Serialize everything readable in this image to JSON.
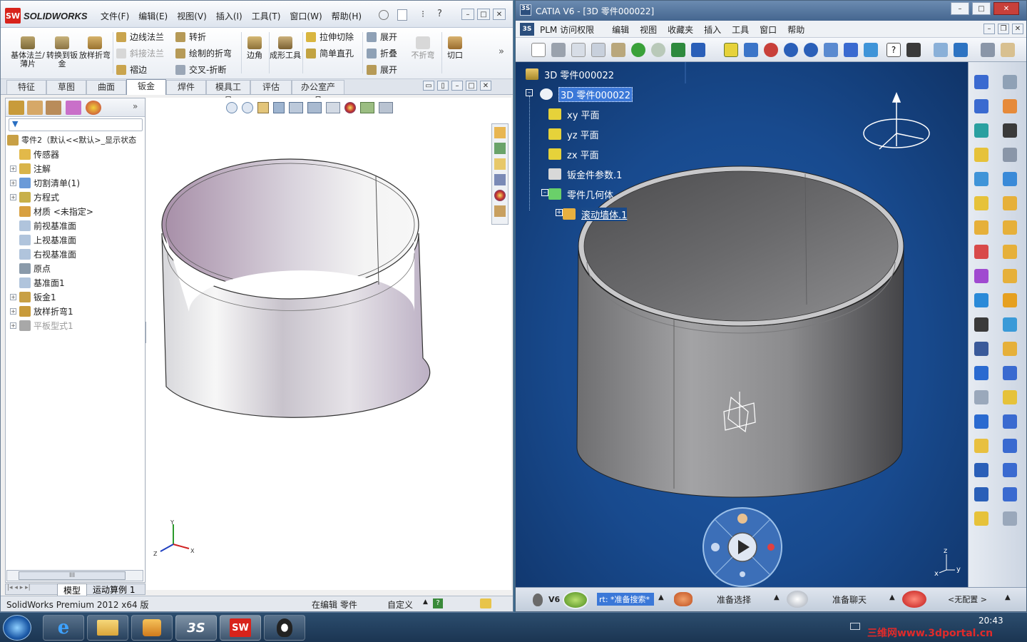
{
  "solidworks": {
    "logo_prefix": "SW",
    "logo_text": "SOLIDWORKS",
    "menu": [
      "文件(F)",
      "编辑(E)",
      "视图(V)",
      "插入(I)",
      "工具(T)",
      "窗口(W)",
      "帮助(H)"
    ],
    "ribbon_big": [
      {
        "label": "基体法兰/薄片"
      },
      {
        "label": "转换到钣金"
      },
      {
        "label": "放样折弯"
      }
    ],
    "ribbon_col1": [
      {
        "label": "边线法兰",
        "disabled": false
      },
      {
        "label": "斜接法兰",
        "disabled": true
      },
      {
        "label": "褶边",
        "disabled": false
      }
    ],
    "ribbon_col2": [
      {
        "label": "转折"
      },
      {
        "label": "绘制的折弯"
      },
      {
        "label": "交叉-折断"
      }
    ],
    "ribbon_corner": "边角",
    "ribbon_forming": "成形工具",
    "ribbon_col3": [
      {
        "label": "拉伸切除"
      },
      {
        "label": "简单直孔"
      }
    ],
    "ribbon_col4": [
      {
        "label": "展开"
      },
      {
        "label": "折叠"
      },
      {
        "label": "展开"
      }
    ],
    "ribbon_unbend": "不折弯",
    "ribbon_cut": "切口",
    "tabs": [
      "特征",
      "草图",
      "曲面",
      "钣金",
      "焊件",
      "模具工具",
      "评估",
      "办公室产品"
    ],
    "active_tab": "钣金",
    "tree_root": "零件2（默认<<默认>_显示状态",
    "tree": [
      {
        "label": "传感器",
        "exp": false
      },
      {
        "label": "注解",
        "exp": true
      },
      {
        "label": "切割清单(1)",
        "exp": true
      },
      {
        "label": "方程式",
        "exp": true
      },
      {
        "label": "材质 <未指定>",
        "exp": false
      },
      {
        "label": "前视基准面",
        "exp": false
      },
      {
        "label": "上视基准面",
        "exp": false
      },
      {
        "label": "右视基准面",
        "exp": false
      },
      {
        "label": "原点",
        "exp": false
      },
      {
        "label": "基准面1",
        "exp": false
      },
      {
        "label": "钣金1",
        "exp": true
      },
      {
        "label": "放样折弯1",
        "exp": true
      },
      {
        "label": "平板型式1",
        "exp": true,
        "grey": true
      }
    ],
    "bottom_tabs": [
      "模型",
      "运动算例 1"
    ],
    "status_left": "SolidWorks Premium 2012 x64 版",
    "status_mid": "在编辑 零件",
    "status_right": "自定义",
    "scrollbar_grip": "III",
    "triad": {
      "x": "X",
      "y": "Y",
      "z": "Z"
    }
  },
  "catia": {
    "title": "CATIA V6 - [3D 零件000022]",
    "menu": [
      "PLM 访问权限",
      "编辑",
      "视图",
      "收藏夹",
      "插入",
      "工具",
      "窗口",
      "帮助"
    ],
    "tree_root": "3D 零件000022",
    "tree_part": "3D 零件000022",
    "tree": [
      {
        "label": "xy 平面"
      },
      {
        "label": "yz 平面"
      },
      {
        "label": "zx 平面"
      },
      {
        "label": "钣金件参数.1"
      },
      {
        "label": "零件几何体"
      },
      {
        "label": "滚动墙体.1"
      }
    ],
    "status": {
      "v6": "V6",
      "search_text": "rt: *准备搜索*",
      "select_text": "准备选择",
      "chat_text": "准备聊天",
      "config_text": "<无配置 >"
    },
    "triad": {
      "y": "y",
      "z": "z",
      "x": "x"
    }
  },
  "taskbar": {
    "clock": "20:43",
    "watermark": "三维网www.3dportal.cn",
    "apps": [
      "windows-start",
      "internet-explorer",
      "file-explorer",
      "media-player",
      "catia-3ds",
      "solidworks",
      "qq"
    ]
  },
  "colors": {
    "sw_red": "#d8231b",
    "catia_blue": "#1f5aa8",
    "highlight": "#3b78d8"
  }
}
